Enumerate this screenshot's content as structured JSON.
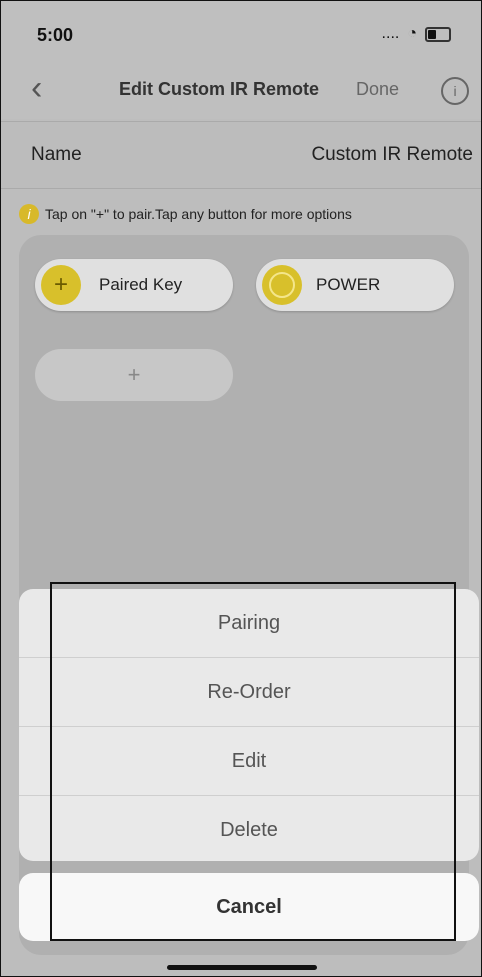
{
  "status": {
    "time": "5:00",
    "signal": "....",
    "wifi": "wifi-icon",
    "battery": "battery-icon"
  },
  "navbar": {
    "title": "Edit Custom IR Remote",
    "done_label": "Done",
    "back_icon": "chevron-left-icon",
    "info_icon": "info-icon"
  },
  "name_row": {
    "label": "Name",
    "value": "Custom IR Remote"
  },
  "hint": {
    "text": "Tap on \"+\" to pair.Tap any button for more options"
  },
  "keys": [
    {
      "label": "Paired Key",
      "icon": "plus-icon"
    },
    {
      "label": "POWER",
      "icon": "circle-icon"
    }
  ],
  "add_key": {
    "label": "+"
  },
  "action_sheet": {
    "items": [
      "Pairing",
      "Re-Order",
      "Edit",
      "Delete"
    ],
    "cancel_label": "Cancel"
  },
  "colors": {
    "accent": "#d8c02b",
    "overlay": "#bdbdbd"
  }
}
